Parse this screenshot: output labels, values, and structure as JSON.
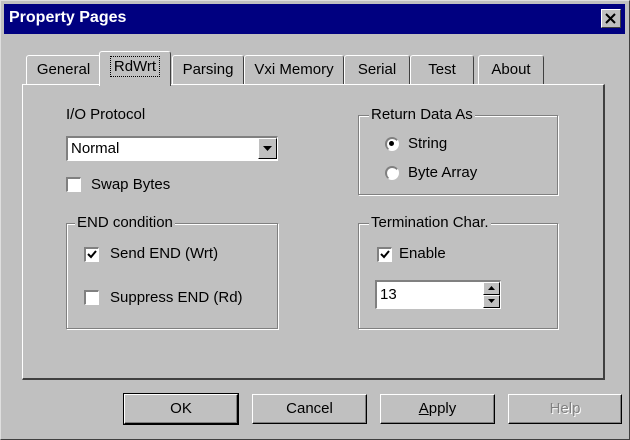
{
  "window": {
    "title": "Property Pages",
    "close_icon": "close-x-icon"
  },
  "tabs": [
    {
      "label": "General",
      "active": false
    },
    {
      "label": "RdWrt",
      "active": true
    },
    {
      "label": "Parsing",
      "active": false
    },
    {
      "label": "Vxi Memory",
      "active": false
    },
    {
      "label": "Serial",
      "active": false
    },
    {
      "label": "Test",
      "active": false
    },
    {
      "label": "About",
      "active": false
    }
  ],
  "io_protocol": {
    "label": "I/O Protocol",
    "selected": "Normal"
  },
  "swap_bytes": {
    "label": "Swap Bytes",
    "checked": false
  },
  "end_condition": {
    "title": "END condition",
    "send_end": {
      "label": "Send END (Wrt)",
      "checked": true
    },
    "suppress_end": {
      "label": "Suppress END (Rd)",
      "checked": false
    }
  },
  "return_data": {
    "title": "Return Data As",
    "options": [
      {
        "label": "String",
        "selected": true
      },
      {
        "label": "Byte Array",
        "selected": false
      }
    ]
  },
  "termination": {
    "title": "Termination Char.",
    "enable": {
      "label": "Enable",
      "checked": true
    },
    "value": "13"
  },
  "buttons": {
    "ok": "OK",
    "cancel": "Cancel",
    "apply_prefix": "",
    "apply_underlined": "A",
    "apply_rest": "pply",
    "help": "Help"
  }
}
